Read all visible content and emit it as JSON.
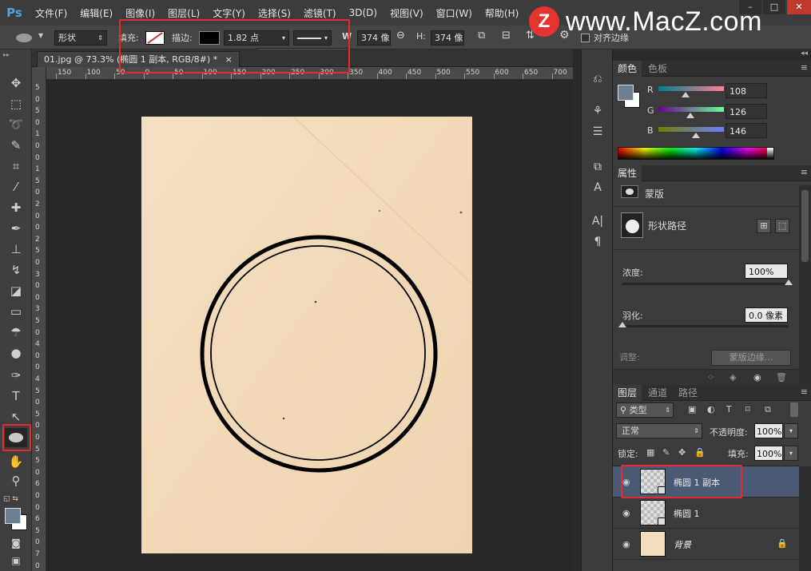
{
  "menubar": {
    "logo": "Ps",
    "items": [
      "文件(F)",
      "编辑(E)",
      "图像(I)",
      "图层(L)",
      "文字(Y)",
      "选择(S)",
      "滤镜(T)",
      "3D(D)",
      "视图(V)",
      "窗口(W)",
      "帮助(H)"
    ]
  },
  "watermark": {
    "badge": "Z",
    "text": "www.MacZ.com"
  },
  "options": {
    "mode": "形状",
    "fill_label": "填充:",
    "stroke_label": "描边:",
    "stroke_width": "1.82 点",
    "w_label": "W",
    "w_value": "374 像",
    "h_label": "H:",
    "h_value": "374 像",
    "align_edges": "对齐边缘"
  },
  "document": {
    "tab_title": "01.jpg @ 73.3% (椭圆 1 副本, RGB/8#) *",
    "close": "×"
  },
  "rulers": {
    "h": [
      "150",
      "100",
      "50",
      "0",
      "50",
      "100",
      "150",
      "200",
      "250",
      "300",
      "350",
      "400",
      "450",
      "500",
      "550",
      "600",
      "650",
      "700"
    ],
    "v": [
      "5",
      "0",
      "5",
      "0",
      "1",
      "0",
      "0",
      "1",
      "5",
      "0",
      "2",
      "0",
      "0",
      "2",
      "5",
      "0",
      "3",
      "0",
      "0",
      "3",
      "5",
      "0",
      "4",
      "0",
      "0",
      "4",
      "5",
      "0",
      "5",
      "0",
      "0",
      "5",
      "5",
      "0",
      "6",
      "0",
      "0",
      "6",
      "5",
      "0",
      "7",
      "0"
    ]
  },
  "color_panel": {
    "tabs": [
      "颜色",
      "色板"
    ],
    "channels": [
      {
        "label": "R",
        "value": "108",
        "fraction": 0.42
      },
      {
        "label": "G",
        "value": "126",
        "fraction": 0.49
      },
      {
        "label": "B",
        "value": "146",
        "fraction": 0.57
      }
    ],
    "foreground": "#6c7e92",
    "background": "#ffffff"
  },
  "properties_panel": {
    "tab": "属性",
    "mask_label": "蒙版",
    "shape_path_label": "形状路径",
    "density_label": "浓度:",
    "density_value": "100%",
    "density_fraction": 1.0,
    "feather_label": "羽化:",
    "feather_value": "0.0 像素",
    "feather_fraction": 0.0,
    "adjust_label": "调整:",
    "mask_edge_button": "蒙版边缘..."
  },
  "layers_panel": {
    "tabs": [
      "图层",
      "通道",
      "路径"
    ],
    "filter_kind": "类型",
    "blend_mode": "正常",
    "opacity_label": "不透明度:",
    "opacity_value": "100%",
    "lock_label": "锁定:",
    "fill_label": "填充:",
    "fill_value": "100%",
    "layers": [
      {
        "name": "椭圆 1 副本",
        "selected": true
      },
      {
        "name": "椭圆 1",
        "selected": false
      },
      {
        "name": "背景",
        "selected": false
      }
    ]
  },
  "colors": {
    "paper": "#f2dcbc",
    "accent_red": "#e52b2b",
    "selected_layer": "#4a5a74",
    "ps_blue": "#4fa3e0"
  }
}
